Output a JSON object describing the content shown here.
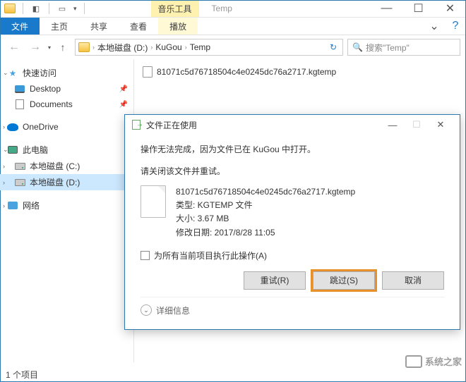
{
  "titlebar": {
    "context_tab": "音乐工具",
    "window_title": "Temp"
  },
  "ribbon": {
    "file": "文件",
    "tabs": [
      "主页",
      "共享",
      "查看"
    ],
    "context_tab": "播放"
  },
  "breadcrumb": {
    "segments": [
      "本地磁盘 (D:)",
      "KuGou",
      "Temp"
    ]
  },
  "search": {
    "placeholder": "搜索\"Temp\""
  },
  "sidebar": {
    "quick_access": "快速访问",
    "desktop": "Desktop",
    "documents": "Documents",
    "onedrive": "OneDrive",
    "this_pc": "此电脑",
    "drive_c": "本地磁盘 (C:)",
    "drive_d": "本地磁盘 (D:)",
    "network": "网络"
  },
  "content": {
    "file_name": "81071c5d76718504c4e0245dc76a2717.kgtemp"
  },
  "dialog": {
    "title": "文件正在使用",
    "msg1": "操作无法完成，因为文件已在 KuGou 中打开。",
    "msg2": "请关闭该文件并重试。",
    "file_name": "81071c5d76718504c4e0245dc76a2717.kgtemp",
    "file_type": "类型: KGTEMP 文件",
    "file_size": "大小: 3.67 MB",
    "file_date": "修改日期: 2017/8/28 11:05",
    "checkbox_label": "为所有当前项目执行此操作(A)",
    "retry": "重试(R)",
    "skip": "跳过(S)",
    "cancel": "取消",
    "details": "详细信息"
  },
  "status": {
    "item_count": "1 个项目"
  },
  "watermark": "系统之家"
}
